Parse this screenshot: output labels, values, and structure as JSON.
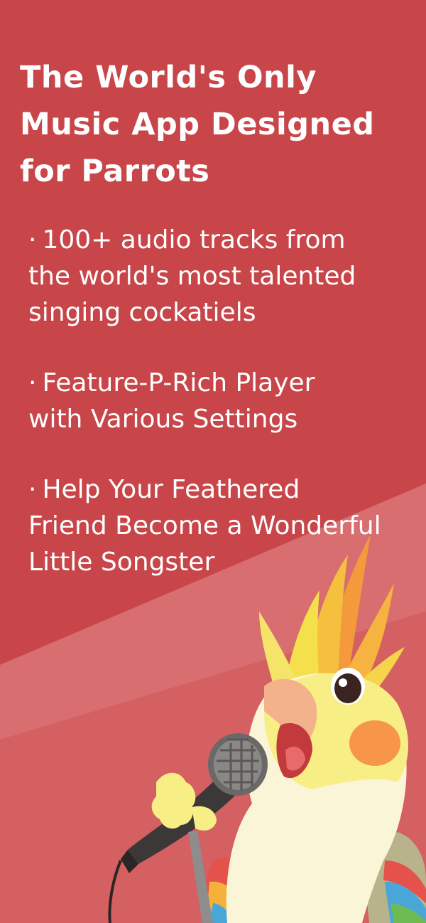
{
  "headline": {
    "lines": [
      "The World's Only",
      "Music App Designed",
      "for Parrots"
    ]
  },
  "features": [
    {
      "bullet": "·",
      "lines": [
        "100+ audio tracks from",
        "the world's most talented",
        "singing cockatiels"
      ]
    },
    {
      "bullet": "·",
      "lines": [
        "Feature-P-Rich Player",
        "with Various Settings"
      ]
    },
    {
      "bullet": "·",
      "lines": [
        "Help Your Feathered",
        "Friend Become a Wonderful",
        "Little Songster"
      ]
    }
  ],
  "illustration": {
    "subject": "cockatiel-singing-into-microphone",
    "icon": "cockatiel-icon"
  },
  "colors": {
    "background": "#c84649",
    "background_lower": "#d46062",
    "background_band": "#d87274",
    "text": "#ffffff",
    "crest_yellow": "#f4e04a",
    "crest_orange": "#f59a3c",
    "cheek": "#f79548",
    "body_cream": "#fbf5d8",
    "mic": "#3c3838"
  }
}
